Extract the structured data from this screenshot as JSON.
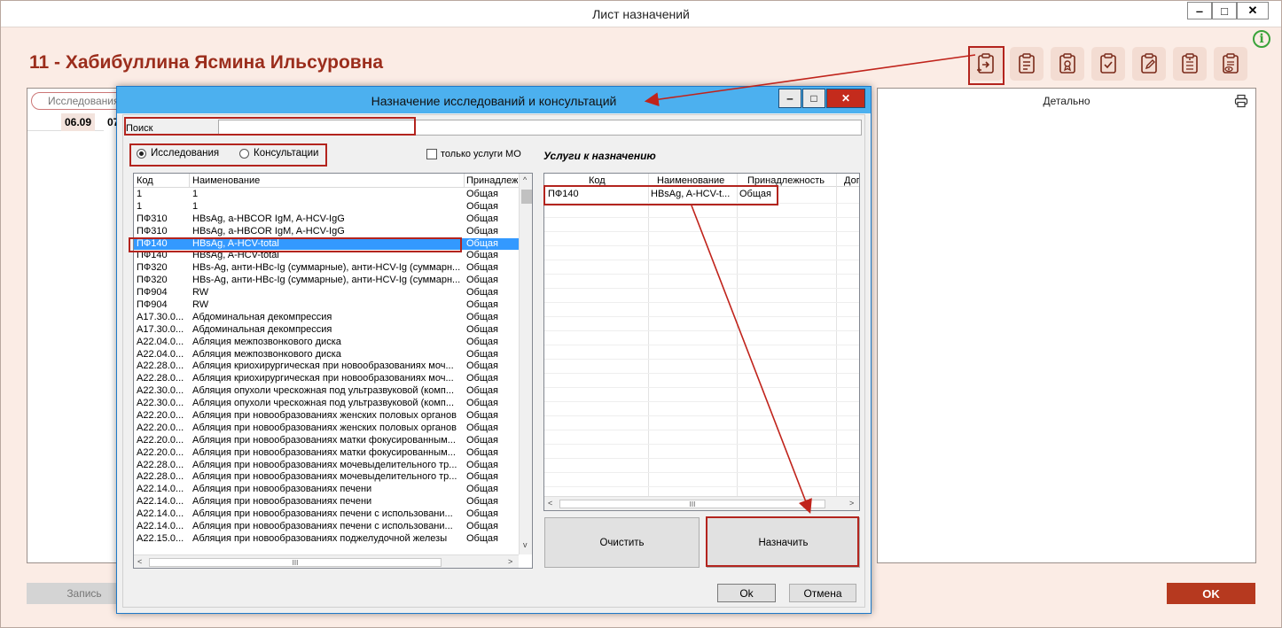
{
  "window": {
    "title": "Лист назначений",
    "minimize": "‒",
    "maximize": "□",
    "close": "✕"
  },
  "patient": {
    "name": "11 - Хабибуллина Ясмина Ильсуровна"
  },
  "left_panel": {
    "tab_label": "Исследования",
    "dates": [
      "06.09",
      "07"
    ]
  },
  "right_panel": {
    "detail_label": "Детально"
  },
  "bottom": {
    "record_label": "Запись",
    "ok_label": "OK"
  },
  "colors": {
    "accent": "#b6391f",
    "title_text": "#9b2d1c",
    "dialog_titlebar": "#4cb0ef",
    "highlight": "#b3241e",
    "selection": "#3399ff"
  },
  "toolbar_icons": [
    "clipboard-assign-icon",
    "clipboard-add-icon",
    "clipboard-medal-icon",
    "clipboard-check-icon",
    "clipboard-edit-icon",
    "clipboard-list-icon",
    "clipboard-view-icon"
  ],
  "dialog": {
    "title": "Назначение исследований и консультаций",
    "search": {
      "label": "Поиск",
      "value": ""
    },
    "radio": {
      "research": "Исследования",
      "consult": "Консультации",
      "selected": "research"
    },
    "mo_only_label": "только услуги МО",
    "list": {
      "headers": [
        "Код",
        "Наименование",
        "Принадлеж"
      ],
      "rows": [
        [
          "1",
          "1",
          "Общая"
        ],
        [
          "1",
          "1",
          "Общая"
        ],
        [
          "ПФ310",
          "HBsAg, a-HBCOR IgM, A-HCV-IgG",
          "Общая"
        ],
        [
          "ПФ310",
          "HBsAg, a-HBCOR IgM, A-HCV-IgG",
          "Общая"
        ],
        [
          "ПФ140",
          "HBsAg, A-HCV-total",
          "Общая"
        ],
        [
          "ПФ140",
          "HBsAg, A-HCV-total",
          "Общая"
        ],
        [
          "ПФ320",
          "HBs-Ag, анти-HBc-Ig (суммарные), анти-HCV-Ig (суммарн...",
          "Общая"
        ],
        [
          "ПФ320",
          "HBs-Ag, анти-HBc-Ig (суммарные), анти-HCV-Ig (суммарн...",
          "Общая"
        ],
        [
          "ПФ904",
          "RW",
          "Общая"
        ],
        [
          "ПФ904",
          "RW",
          "Общая"
        ],
        [
          "A17.30.0...",
          "Абдоминальная декомпрессия",
          "Общая"
        ],
        [
          "A17.30.0...",
          "Абдоминальная декомпрессия",
          "Общая"
        ],
        [
          "A22.04.0...",
          "Абляция межпозвонкового диска",
          "Общая"
        ],
        [
          "A22.04.0...",
          "Абляция межпозвонкового диска",
          "Общая"
        ],
        [
          "A22.28.0...",
          "Абляция криохирургическая при новообразованиях моч...",
          "Общая"
        ],
        [
          "A22.28.0...",
          "Абляция криохирургическая при новообразованиях моч...",
          "Общая"
        ],
        [
          "A22.30.0...",
          "Абляция опухоли чрескожная под ультразвуковой (комп...",
          "Общая"
        ],
        [
          "A22.30.0...",
          "Абляция опухоли чрескожная под ультразвуковой (комп...",
          "Общая"
        ],
        [
          "A22.20.0...",
          "Абляция при новообразованиях женских половых органов",
          "Общая"
        ],
        [
          "A22.20.0...",
          "Абляция при новообразованиях женских половых органов",
          "Общая"
        ],
        [
          "A22.20.0...",
          "Абляция при новообразованиях матки фокусированным...",
          "Общая"
        ],
        [
          "A22.20.0...",
          "Абляция при новообразованиях матки фокусированным...",
          "Общая"
        ],
        [
          "A22.28.0...",
          "Абляция при новообразованиях мочевыделительного тр...",
          "Общая"
        ],
        [
          "A22.28.0...",
          "Абляция при новообразованиях мочевыделительного тр...",
          "Общая"
        ],
        [
          "A22.14.0...",
          "Абляция при новообразованиях печени",
          "Общая"
        ],
        [
          "A22.14.0...",
          "Абляция при новообразованиях печени",
          "Общая"
        ],
        [
          "A22.14.0...",
          "Абляция при новообразованиях печени с использовани...",
          "Общая"
        ],
        [
          "A22.14.0...",
          "Абляция при новообразованиях печени с использовани...",
          "Общая"
        ],
        [
          "A22.15.0...",
          "Абляция при новообразованиях поджелудочной железы",
          "Общая"
        ]
      ],
      "selected_index": 4,
      "scroll_left": "<",
      "scroll_right": ">",
      "scroll_up": "^",
      "scroll_down": "v",
      "scroll_thumb": "III"
    },
    "assign": {
      "title": "Услуги к назначению",
      "headers": [
        "Код",
        "Наименование",
        "Принадлежность",
        "Доп"
      ],
      "rows": [
        [
          "ПФ140",
          "HBsAg, A-HCV-t...",
          "Общая"
        ]
      ],
      "scroll_thumb": "III"
    },
    "clear_label": "Очистить",
    "assign_label": "Назначить",
    "ok_label": "Ok",
    "cancel_label": "Отмена"
  }
}
